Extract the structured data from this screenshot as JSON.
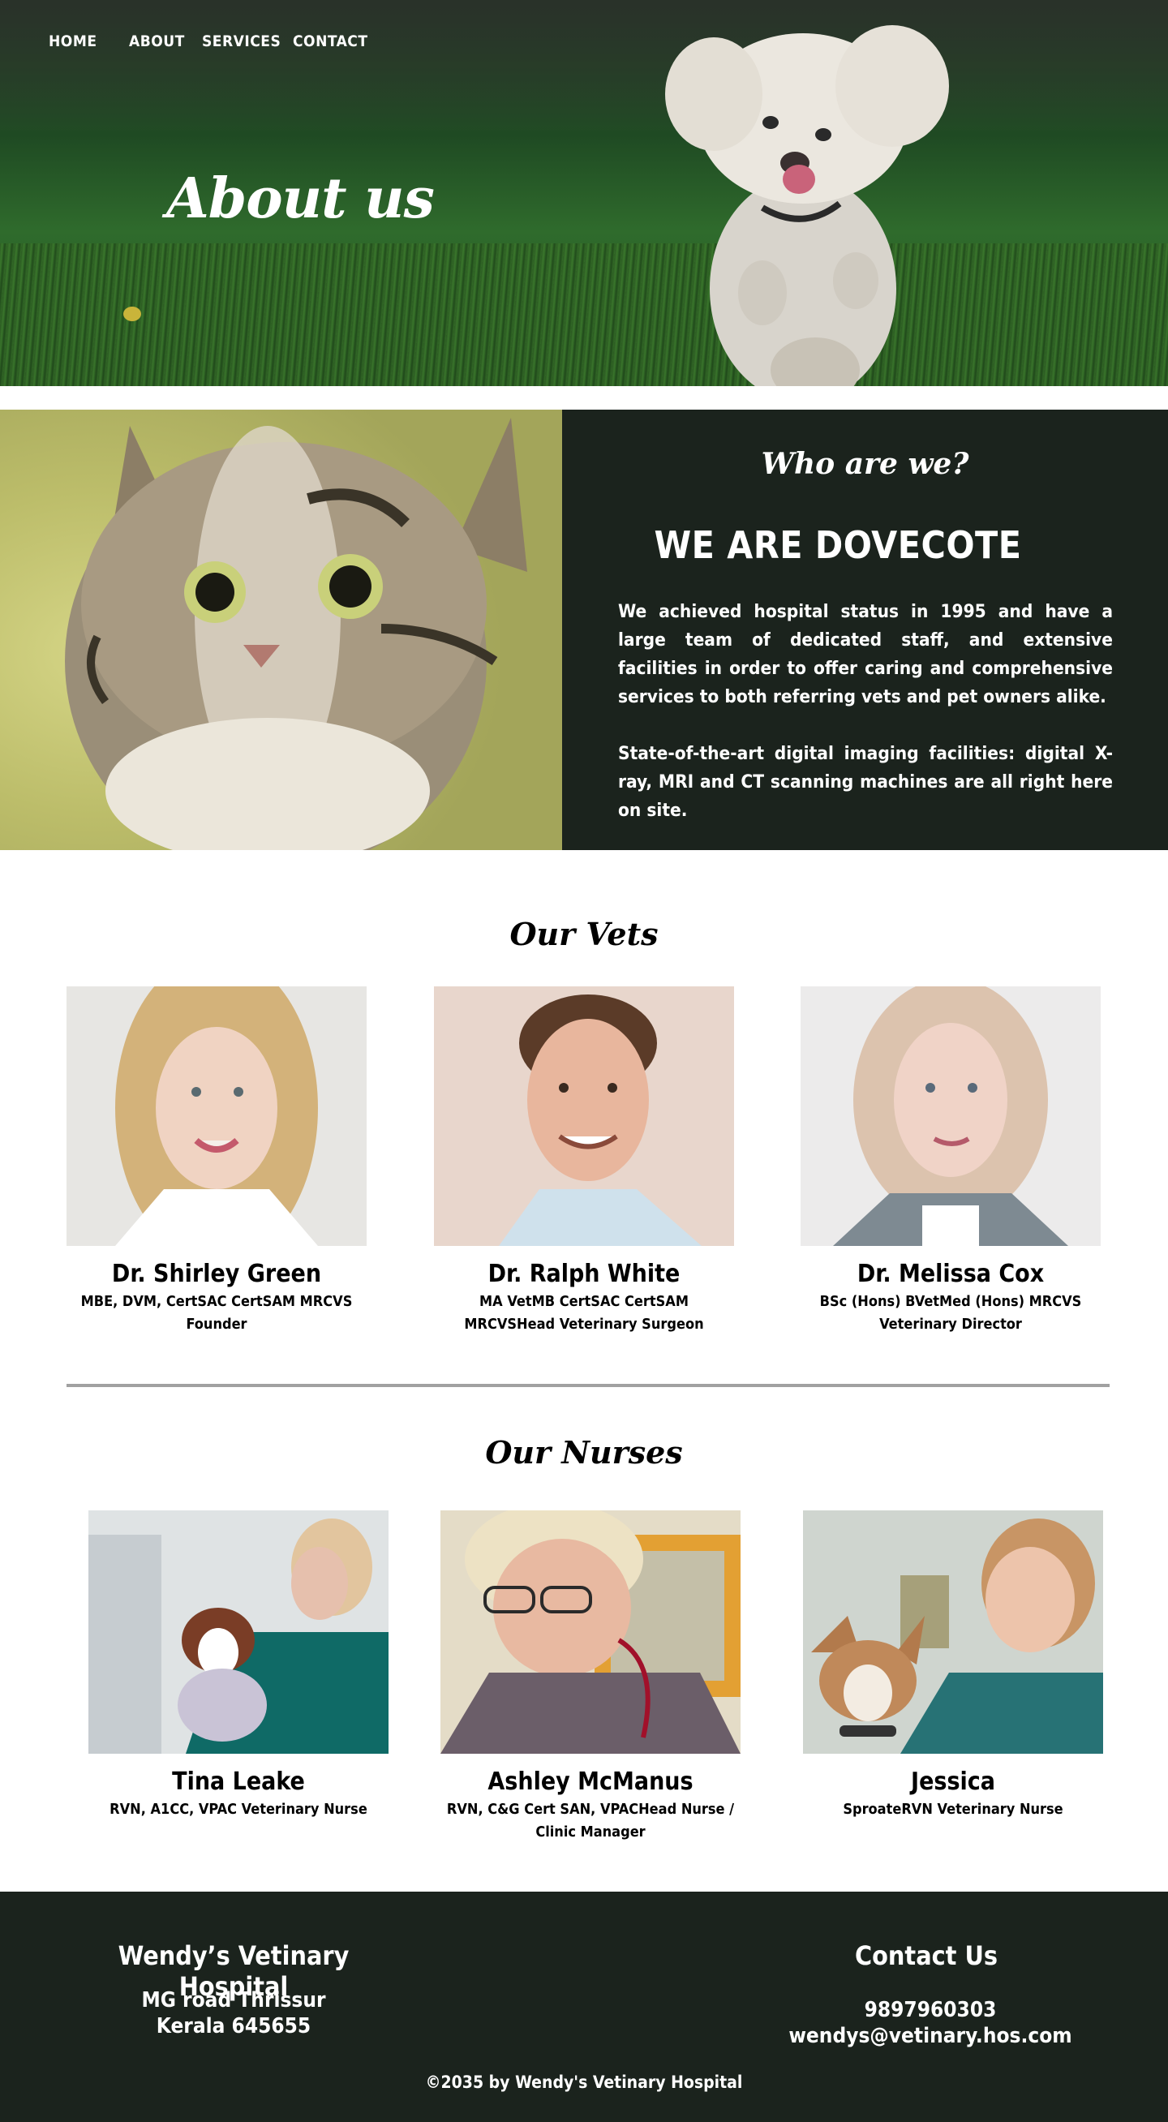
{
  "nav": {
    "items": [
      "HOME",
      "ABOUT",
      "SERVICES",
      "CONTACT"
    ]
  },
  "hero": {
    "title": "About us"
  },
  "about": {
    "subtitle": "Who are we?",
    "title": "WE ARE DOVECOTE",
    "paragraph1": "We achieved hospital status in 1995 and have a large team of dedicated staff, and extensive facilities in order to offer caring and comprehensive services to both referring vets and pet owners alike.",
    "paragraph2": "State-of-the-art digital imaging facilities: digital X-ray, MRI and CT scanning machines are all right here on site."
  },
  "vets": {
    "title": "Our Vets",
    "members": [
      {
        "name": "Dr. Shirley Green",
        "role": "MBE, DVM, CertSAC CertSAM MRCVS Founder"
      },
      {
        "name": "Dr. Ralph White",
        "role": "MA VetMB CertSAC CertSAM MRCVSHead Veterinary Surgeon"
      },
      {
        "name": "Dr. Melissa Cox",
        "role": "BSc (Hons) BVetMed (Hons) MRCVS Veterinary Director"
      }
    ]
  },
  "nurses": {
    "title": "Our Nurses",
    "members": [
      {
        "name": "Tina Leake",
        "role": "RVN, A1CC, VPAC Veterinary Nurse"
      },
      {
        "name": "Ashley McManus",
        "role": "RVN, C&G Cert SAN, VPACHead Nurse / Clinic Manager"
      },
      {
        "name": "Jessica",
        "role": "SproateRVN Veterinary Nurse"
      }
    ]
  },
  "footer": {
    "hospital_name": "Wendy’s Vetinary Hospital",
    "address_line1": "MG road Thrissur",
    "address_line2": "Kerala 645655",
    "contact_title": "Contact Us",
    "phone": "9897960303",
    "email": "wendys@vetinary.hos.com",
    "copyright": "©2035 by Wendy's Vetinary Hospital"
  }
}
